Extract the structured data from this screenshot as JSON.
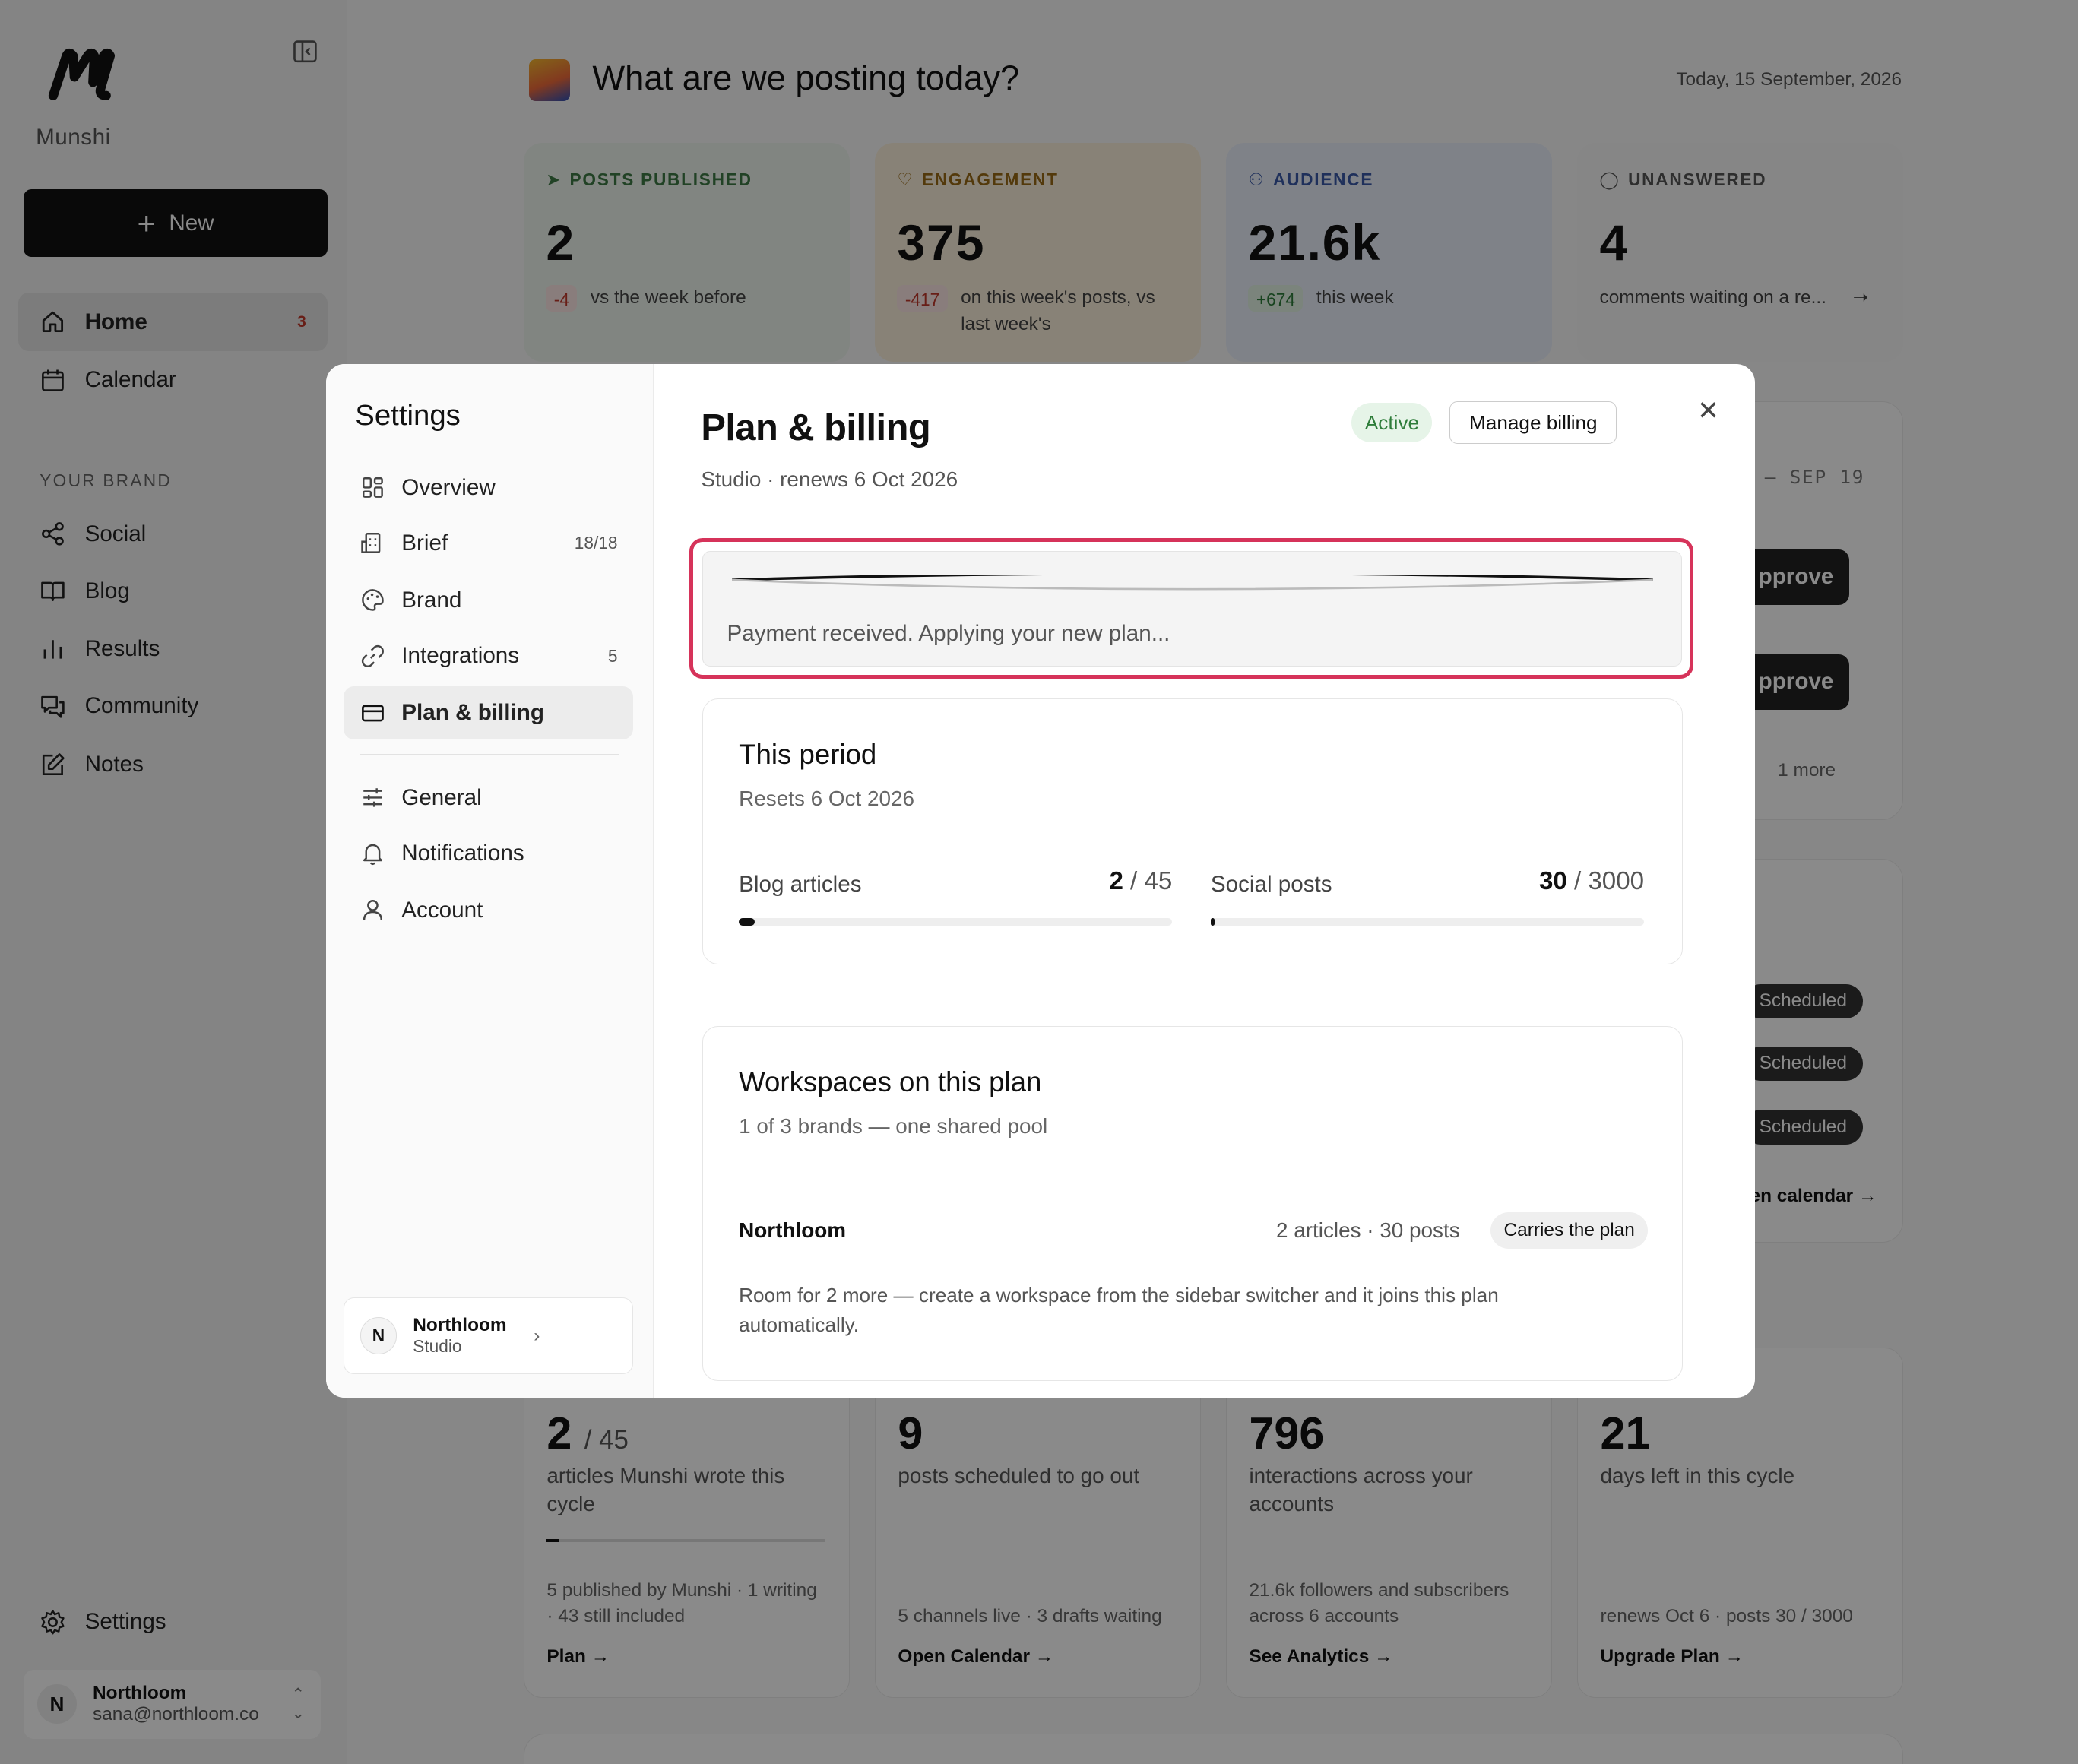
{
  "app": {
    "brand": "Munshi"
  },
  "sidebar": {
    "new_label": "New",
    "nav": [
      {
        "label": "Home",
        "badge": "3"
      },
      {
        "label": "Calendar"
      }
    ],
    "section_label": "YOUR BRAND",
    "brand_nav": [
      {
        "label": "Social"
      },
      {
        "label": "Blog"
      },
      {
        "label": "Results"
      },
      {
        "label": "Community"
      },
      {
        "label": "Notes"
      }
    ],
    "settings_label": "Settings",
    "user": {
      "initial": "N",
      "name": "Northloom",
      "email": "sana@northloom.co"
    }
  },
  "header": {
    "title": "What are we posting today?",
    "date": "Today, 15 September, 2026"
  },
  "stats": [
    {
      "label": "POSTS PUBLISHED",
      "value": "2",
      "delta": "-4",
      "delta_text": "vs the week before",
      "color": "#3d7a45"
    },
    {
      "label": "ENGAGEMENT",
      "value": "375",
      "delta": "-417",
      "delta_text": "on this week's posts, vs last week's",
      "color": "#9a6a15"
    },
    {
      "label": "AUDIENCE",
      "value": "21.6k",
      "delta": "+674",
      "delta_text": "this week",
      "color": "#3a5aa8"
    },
    {
      "label": "UNANSWERED",
      "value": "4",
      "delta_text": "comments waiting on a re...",
      "color": "#555555"
    }
  ],
  "background": {
    "week_range": "– SEP 19",
    "approve_label": "pprove",
    "more_link": "1 more",
    "scheduled_label": "Scheduled",
    "calendar_link": "en calendar →"
  },
  "bottom_stats": [
    {
      "value": "2",
      "value_suffix": "/ 45",
      "desc": "articles Munshi wrote this cycle",
      "sub": "5 published by Munshi · 1 writing · 43 still included",
      "link": "Plan →"
    },
    {
      "value": "9",
      "desc": "posts scheduled to go out",
      "sub": "5 channels live · 3 drafts waiting",
      "link": "Open Calendar →"
    },
    {
      "value": "796",
      "desc": "interactions across your accounts",
      "sub": "21.6k followers and subscribers across 6 accounts",
      "link": "See Analytics →"
    },
    {
      "value": "21",
      "desc": "days left in this cycle",
      "sub": "renews Oct 6 · posts 30 / 3000",
      "link": "Upgrade Plan →"
    }
  ],
  "settings_modal": {
    "title": "Settings",
    "nav": [
      {
        "label": "Overview"
      },
      {
        "label": "Brief",
        "count": "18/18"
      },
      {
        "label": "Brand"
      },
      {
        "label": "Integrations",
        "count": "5"
      },
      {
        "label": "Plan & billing"
      },
      {
        "label": "General"
      },
      {
        "label": "Notifications"
      },
      {
        "label": "Account"
      }
    ],
    "workspace": {
      "initial": "N",
      "name": "Northloom",
      "plan": "Studio"
    },
    "plan": {
      "title": "Plan & billing",
      "subtitle": "Studio · renews 6 Oct 2026",
      "status": "Active",
      "manage_label": "Manage billing",
      "payment_message": "Payment received. Applying your new plan...",
      "period": {
        "title": "This period",
        "subtitle": "Resets 6 Oct 2026",
        "usage": [
          {
            "label": "Blog articles",
            "used": "2",
            "limit": "45",
            "fraction": 0.044
          },
          {
            "label": "Social posts",
            "used": "30",
            "limit": "3000",
            "fraction": 0.01
          }
        ]
      },
      "workspaces": {
        "title": "Workspaces on this plan",
        "subtitle": "1 of 3 brands — one shared pool",
        "rows": [
          {
            "name": "Northloom",
            "stats": "2 articles · 30 posts",
            "tag": "Carries the plan"
          }
        ],
        "note": "Room for 2 more — create a workspace from the sidebar switcher and it joins this plan automatically."
      }
    }
  }
}
